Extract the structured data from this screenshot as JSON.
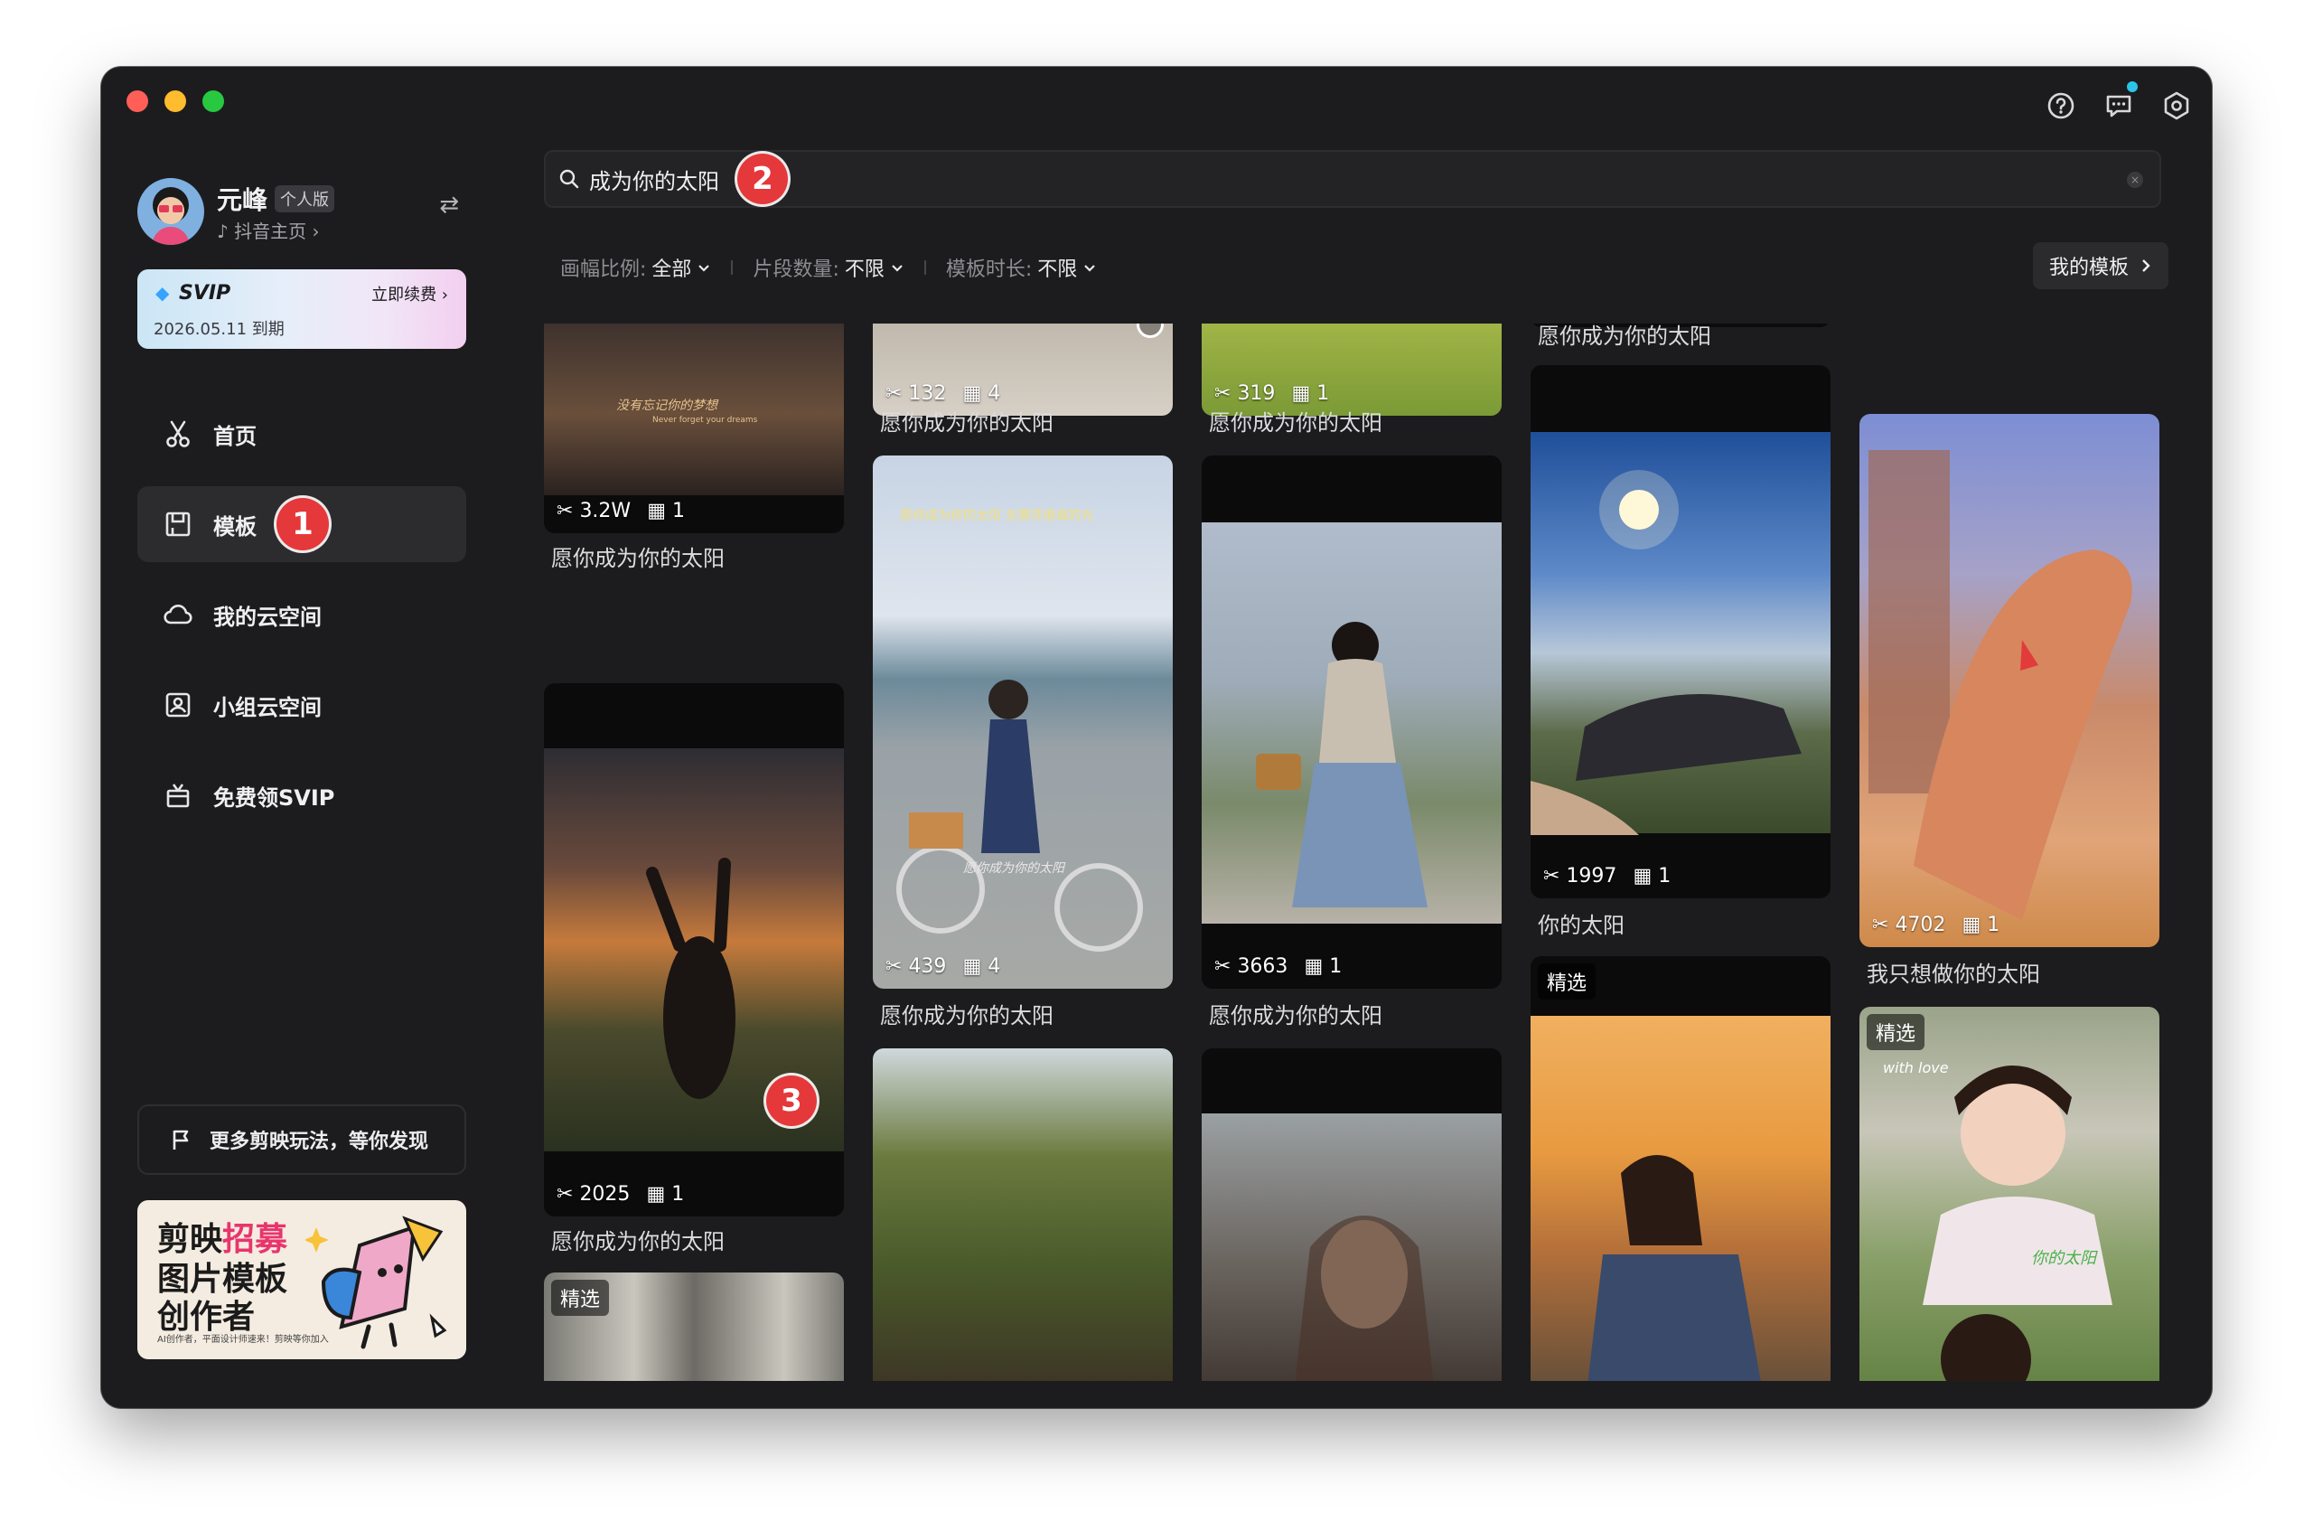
{
  "profile": {
    "name": "元峰",
    "edition_badge": "个人版",
    "douyin_link": "♪ 抖音主页 ›"
  },
  "svip": {
    "label": "SVIP",
    "renew": "立即续费 ›",
    "expiry": "2026.05.11 到期"
  },
  "nav": {
    "items": [
      {
        "label": "首页"
      },
      {
        "label": "模板",
        "step": "1"
      },
      {
        "label": "我的云空间"
      },
      {
        "label": "小组云空间"
      },
      {
        "label": "免费领SVIP"
      }
    ]
  },
  "promo": {
    "label": "更多剪映玩法，等你发现"
  },
  "banner": {
    "line1a": "剪映",
    "line1b": "招募",
    "line2": "图片模板",
    "line3": "创作者",
    "fine": "AI创作者，平面设计师速来！剪映等你加入"
  },
  "search": {
    "query": "成为你的太阳",
    "step": "2",
    "clear": "×"
  },
  "filters": [
    {
      "label": "画幅比例:",
      "value": "全部"
    },
    {
      "label": "片段数量:",
      "value": "不限"
    },
    {
      "label": "模板时长:",
      "value": "不限"
    }
  ],
  "my_templates": "我的模板",
  "card_step": "3",
  "featured_tag": "精选",
  "cards": [
    {
      "uses": "3.2W",
      "clips": "1",
      "caption": "愿你成为你的太阳"
    },
    {
      "uses": "2025",
      "clips": "1",
      "caption": "愿你成为你的太阳"
    },
    {
      "uses": "132",
      "clips": "4",
      "caption": "愿你成为你的太阳"
    },
    {
      "uses": "439",
      "clips": "4",
      "caption": "愿你成为你的太阳"
    },
    {
      "uses": "319",
      "clips": "1",
      "caption": "愿你成为你的太阳"
    },
    {
      "uses": "3663",
      "clips": "1",
      "caption": "愿你成为你的太阳"
    },
    {
      "caption": "愿你成为你的太阳"
    },
    {
      "uses": "1997",
      "clips": "1",
      "caption": "你的太阳"
    },
    {
      "uses": "4702",
      "clips": "1",
      "caption": "我只想做你的太阳"
    }
  ],
  "overlay_text": {
    "c1": "没有忘记你的梦想",
    "c1b": "Never forget your dreams",
    "c4": "愿你成为你的太阳 无需凭借谁的光",
    "c4b": "愿你成为你的太阳",
    "c_right": "with love",
    "c_right2": "你的太阳"
  },
  "colors": {
    "window_bg": "#1c1c1e",
    "accent_step": "#e5383b",
    "svip_gem": "#36a3ff"
  }
}
